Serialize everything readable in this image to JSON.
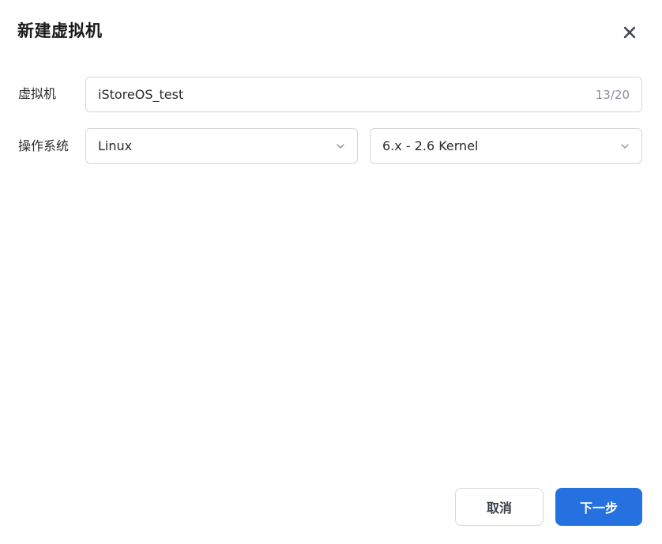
{
  "dialog": {
    "title": "新建虚拟机",
    "close_icon": "close-icon"
  },
  "form": {
    "vm_name": {
      "label": "虚拟机",
      "value": "iStoreOS_test",
      "char_count": "13/20"
    },
    "os": {
      "label": "操作系统",
      "os_type": "Linux",
      "kernel_version": "6.x - 2.6 Kernel",
      "chevron_icon": "chevron-down-icon"
    }
  },
  "footer": {
    "cancel_label": "取消",
    "next_label": "下一步"
  },
  "colors": {
    "primary": "#2571e0",
    "border": "#d4d7de",
    "muted_text": "#8a8f99"
  }
}
